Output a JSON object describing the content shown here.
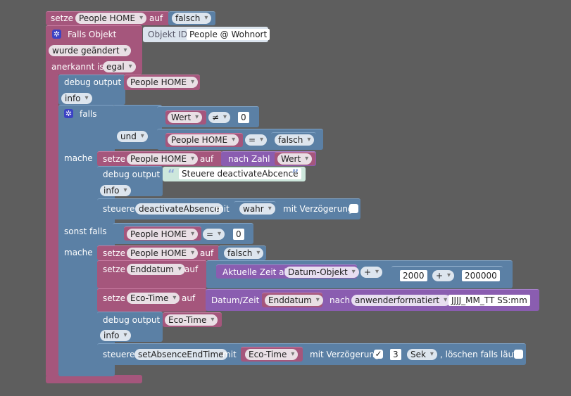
{
  "colors": {
    "background": "#5e5e5e",
    "variables": "#a5567c",
    "system": "#5b80a5",
    "convert": "#8a5db0",
    "text": "#cde7dc"
  },
  "b1": {
    "setze": "setze",
    "var": "People HOME",
    "auf": "auf",
    "val": "falsch"
  },
  "trigger": {
    "falls_objekt": "Falls Objekt",
    "objekt_id_label": "Objekt ID",
    "objekt_id_value": "People @ Wohnort",
    "wurde": "wurde geändert",
    "anerkannt": "anerkannt ist",
    "egal": "egal"
  },
  "debug1": {
    "label": "debug output",
    "value": "People HOME",
    "level": "info"
  },
  "if": {
    "falls": "falls",
    "wert": "Wert",
    "neq": "≠",
    "zero": "0",
    "und": "und",
    "people": "People HOME",
    "eq": "=",
    "falsch": "falsch",
    "mache": "mache"
  },
  "m1": {
    "setze": "setze",
    "var": "People HOME",
    "auf": "auf",
    "nach_zahl": "nach Zahl",
    "wert": "Wert",
    "debug": "debug output",
    "text": "Steuere deactivateAbcence",
    "level": "info",
    "steuere": "steuere",
    "script": "deactivateAbsence",
    "mit": "mit",
    "wahr": "wahr",
    "mit_verz": "mit Verzögerung"
  },
  "elseif": {
    "sonst_falls": "sonst falls",
    "people": "People HOME",
    "eq": "=",
    "zero": "0",
    "mache": "mache"
  },
  "m2": {
    "setze": "setze",
    "var": "People HOME",
    "auf": "auf",
    "falsch": "falsch",
    "setze2": "setze",
    "enddatum": "Enddatum",
    "auf2": "auf",
    "aktuelle": "Aktuelle Zeit als",
    "datum_objekt": "Datum-Objekt",
    "plus": "+",
    "n2000": "2000",
    "plus2": "+",
    "n200000": "200000",
    "setze3": "setze",
    "ecotime": "Eco-Time",
    "auf3": "auf",
    "datumzeit": "Datum/Zeit",
    "enddatum2": "Enddatum",
    "nach": "nach",
    "format": "anwenderformatiert",
    "pattern": "JJJJ_MM_TT SS:mm",
    "debug": "debug output",
    "debug_val": "Eco-Time",
    "level": "info",
    "steuere": "steuere",
    "script": "setAbsenceEndTime",
    "mit": "mit",
    "ecotime2": "Eco-Time",
    "mit_verz": "mit Verzögerung",
    "check": "✓",
    "three": "3",
    "sek": "Sek",
    "loeschen": ", löschen falls läuft"
  }
}
